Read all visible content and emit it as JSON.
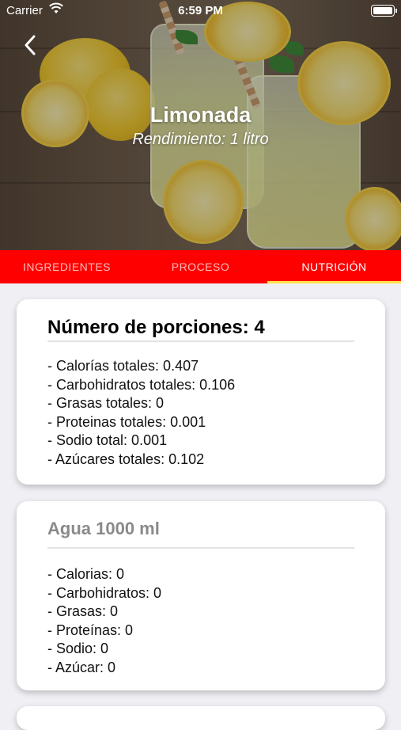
{
  "status_bar": {
    "carrier": "Carrier",
    "time": "6:59 PM"
  },
  "header": {
    "title": "Limonada",
    "subtitle": "Rendimiento: 1 litro"
  },
  "tabs": [
    {
      "label": "INGREDIENTES",
      "active": false
    },
    {
      "label": "PROCESO",
      "active": false
    },
    {
      "label": "NUTRICIÓN",
      "active": true
    }
  ],
  "cards": [
    {
      "title": "Número de porciones: 4",
      "items": [
        "- Calorías totales: 0.407",
        "- Carbohidratos totales: 0.106",
        "- Grasas totales: 0",
        "- Proteinas totales: 0.001",
        "- Sodio total: 0.001",
        "- Azúcares totales: 0.102"
      ]
    },
    {
      "title": "Agua 1000 ml",
      "items": [
        "- Calorias: 0",
        "- Carbohidratos: 0",
        "- Grasas: 0",
        "- Proteínas: 0",
        "- Sodio: 0",
        "- Azúcar: 0"
      ]
    }
  ],
  "colors": {
    "tab_bar": "#ff0000",
    "tab_indicator": "#ffe24a",
    "background": "#efeff4"
  },
  "icons": {
    "back": "chevron-left-icon",
    "wifi": "wifi-icon",
    "battery": "battery-icon"
  }
}
